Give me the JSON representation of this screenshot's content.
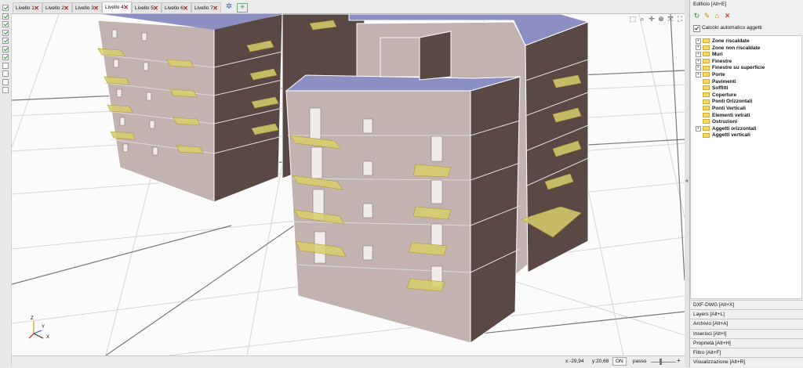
{
  "levels": {
    "tabs": [
      {
        "label": "Livello 1",
        "active": false
      },
      {
        "label": "Livello 2",
        "active": false
      },
      {
        "label": "Livello 3",
        "active": false
      },
      {
        "label": "Livello 4",
        "active": true
      },
      {
        "label": "Livello 5",
        "active": false
      },
      {
        "label": "Livello 6",
        "active": false
      },
      {
        "label": "Livello 7",
        "active": false
      }
    ],
    "close_glyph": "✕",
    "checks": [
      true,
      true,
      true,
      true,
      true,
      true,
      true,
      false,
      false,
      false,
      false
    ]
  },
  "viewport": {
    "axes": {
      "x": "X",
      "y": "Y",
      "z": "Z"
    }
  },
  "status": {
    "x_coord": "x:-29,94",
    "y_coord": "y:20,68",
    "snap_toggle": "ON",
    "step_label": "passo"
  },
  "panel": {
    "title": "Edificio [Alt+E]",
    "auto_calc_label": "Calcolo automatico aggetti",
    "auto_calc_checked": true,
    "tree": [
      {
        "label": "Zone riscaldate",
        "expandable": true
      },
      {
        "label": "Zone non riscaldate",
        "expandable": true
      },
      {
        "label": "Muri",
        "expandable": true
      },
      {
        "label": "Finestre",
        "expandable": true
      },
      {
        "label": "Finestre su superficie",
        "expandable": true
      },
      {
        "label": "Porte",
        "expandable": true
      },
      {
        "label": "Pavimenti",
        "expandable": false
      },
      {
        "label": "Soffitti",
        "expandable": false
      },
      {
        "label": "Coperture",
        "expandable": false
      },
      {
        "label": "Ponti Orizzontali",
        "expandable": false
      },
      {
        "label": "Ponti Verticali",
        "expandable": false
      },
      {
        "label": "Elementi vetrati",
        "expandable": false
      },
      {
        "label": "Ostruzioni",
        "expandable": false
      },
      {
        "label": "Aggetti orizzontali",
        "expandable": true
      },
      {
        "label": "Aggetti verticali",
        "expandable": false
      }
    ],
    "sections": [
      "DXF-DWG [Alt+X]",
      "Layers [Alt+L]",
      "Archivio [Alt+A]",
      "Inserisci [Alt+I]",
      "Proprietà [Alt+H]",
      "Filtro [Alt+F]",
      "Visualizzazione [Alt+R]"
    ]
  },
  "colors": {
    "wall_light": "#c2b2b0",
    "wall_dark": "#5a4845",
    "roof": "#8c8fc2",
    "balcony": "#d8cf6c",
    "accent_check": "#1e9a2a",
    "close_red": "#c0221a"
  }
}
